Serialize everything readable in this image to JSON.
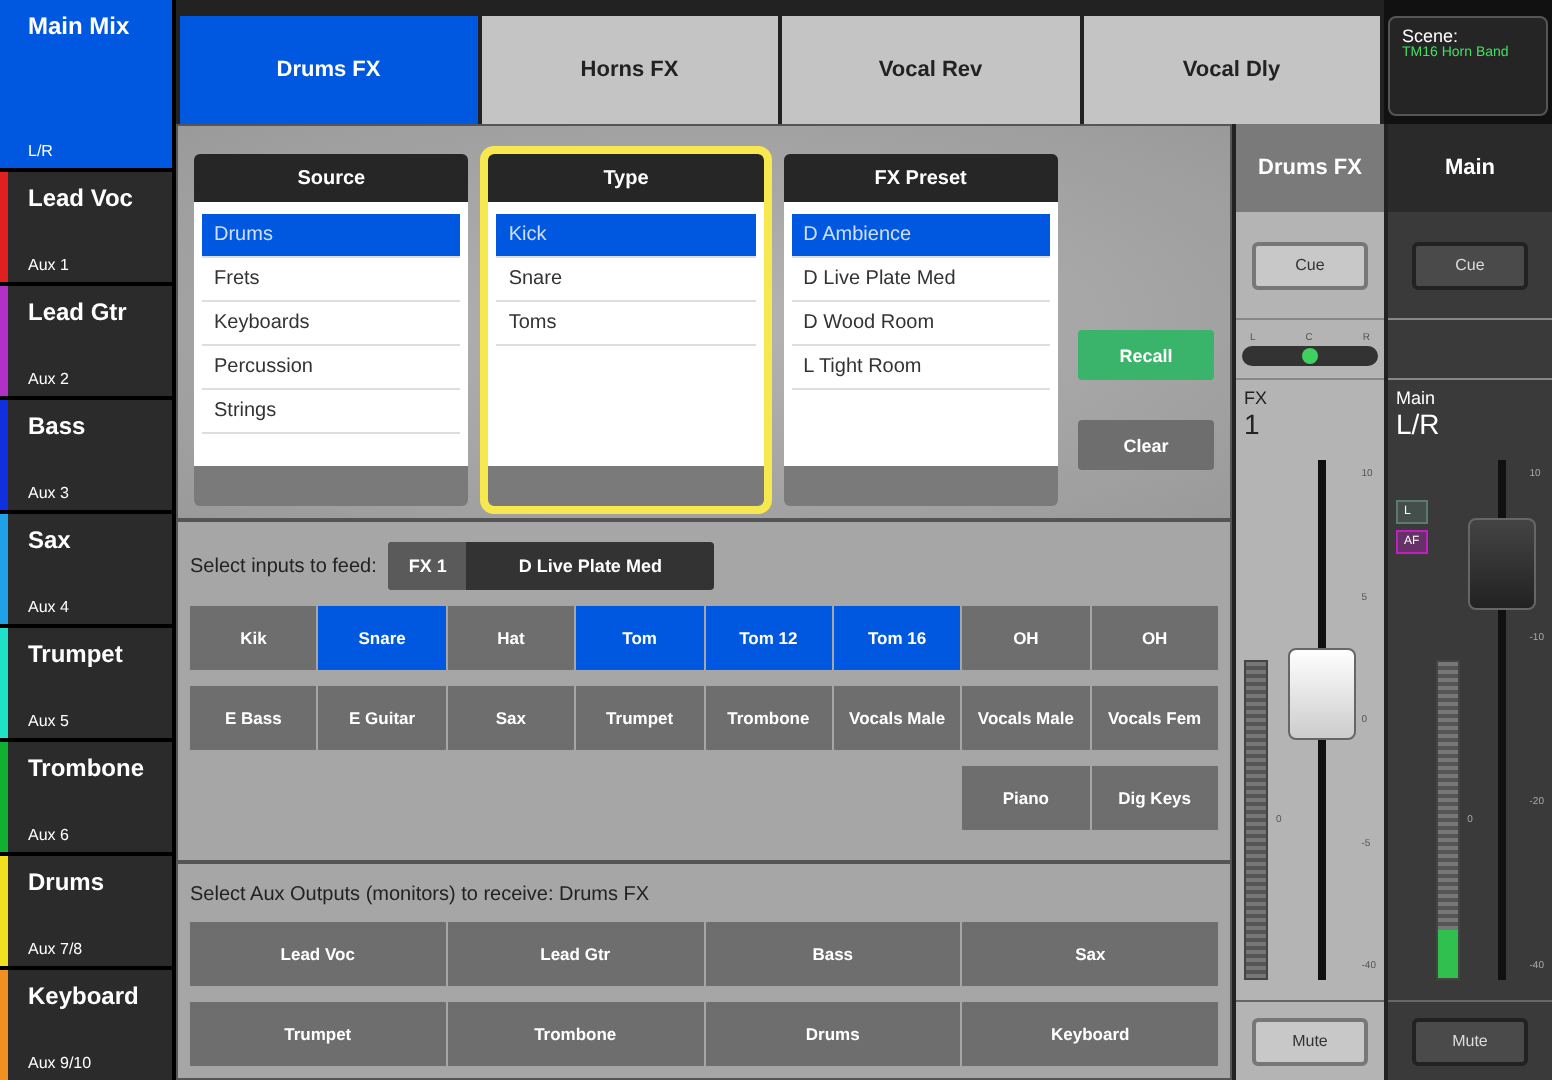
{
  "sidebar": [
    {
      "name": "Main Mix",
      "bus": "L/R",
      "selected": true
    },
    {
      "name": "Lead Voc",
      "bus": "Aux 1",
      "color": "#e02020",
      "selected": false
    },
    {
      "name": "Lead Gtr",
      "bus": "Aux 2",
      "color": "#b030c8",
      "selected": false
    },
    {
      "name": "Bass",
      "bus": "Aux 3",
      "color": "#1030e0",
      "selected": false
    },
    {
      "name": "Sax",
      "bus": "Aux 4",
      "color": "#20a0e8",
      "selected": false
    },
    {
      "name": "Trumpet",
      "bus": "Aux 5",
      "color": "#20e0c8",
      "selected": false
    },
    {
      "name": "Trombone",
      "bus": "Aux 6",
      "color": "#10b030",
      "selected": false
    },
    {
      "name": "Drums",
      "bus": "Aux 7/8",
      "color": "#f0e020",
      "selected": false
    },
    {
      "name": "Keyboard",
      "bus": "Aux 9/10",
      "color": "#f09020",
      "selected": false
    }
  ],
  "tabs": [
    {
      "label": "Drums FX",
      "selected": true
    },
    {
      "label": "Horns FX",
      "selected": false
    },
    {
      "label": "Vocal Rev",
      "selected": false
    },
    {
      "label": "Vocal Dly",
      "selected": false
    }
  ],
  "scene": {
    "label": "Scene:",
    "name": "TM16 Horn Band"
  },
  "pickers": [
    {
      "title": "Source",
      "focused": false,
      "items": [
        {
          "label": "Drums",
          "selected": true
        },
        {
          "label": "Frets",
          "selected": false
        },
        {
          "label": "Keyboards",
          "selected": false
        },
        {
          "label": "Percussion",
          "selected": false
        },
        {
          "label": "Strings",
          "selected": false
        }
      ]
    },
    {
      "title": "Type",
      "focused": true,
      "items": [
        {
          "label": "Kick",
          "selected": true
        },
        {
          "label": "Snare",
          "selected": false
        },
        {
          "label": "Toms",
          "selected": false
        }
      ]
    },
    {
      "title": "FX Preset",
      "focused": false,
      "items": [
        {
          "label": "D Ambience",
          "selected": true
        },
        {
          "label": "D Live Plate Med",
          "selected": false
        },
        {
          "label": "D Wood Room",
          "selected": false
        },
        {
          "label": "L Tight Room",
          "selected": false
        }
      ]
    }
  ],
  "actions": [
    {
      "label": "Recall",
      "kind": "recall"
    },
    {
      "label": "Clear",
      "kind": "clear"
    }
  ],
  "feed": {
    "label": "Select inputs to feed:",
    "fx": "FX 1",
    "preset": "D Live Plate Med"
  },
  "inputs": [
    [
      {
        "label": "Kik",
        "selected": false
      },
      {
        "label": "Snare",
        "selected": true
      },
      {
        "label": "Hat",
        "selected": false
      },
      {
        "label": "Tom",
        "selected": true
      },
      {
        "label": "Tom 12",
        "selected": true
      },
      {
        "label": "Tom 16",
        "selected": true
      },
      {
        "label": "OH",
        "selected": false
      },
      {
        "label": "OH",
        "selected": false
      }
    ],
    [
      {
        "label": "E Bass",
        "selected": false
      },
      {
        "label": "E Guitar",
        "selected": false
      },
      {
        "label": "Sax",
        "selected": false
      },
      {
        "label": "Trumpet",
        "selected": false
      },
      {
        "label": "Trombone",
        "selected": false
      },
      {
        "label": "Vocals Male",
        "selected": false
      },
      {
        "label": "Vocals Male",
        "selected": false
      },
      {
        "label": "Vocals Fem",
        "selected": false
      }
    ],
    [
      {
        "label": "Piano",
        "selected": false
      },
      {
        "label": "Dig Keys",
        "selected": false
      }
    ]
  ],
  "aux": {
    "label": "Select Aux Outputs (monitors) to receive:  Drums FX",
    "outputs": [
      [
        {
          "label": "Lead Voc",
          "selected": false
        },
        {
          "label": "Lead Gtr",
          "selected": false
        },
        {
          "label": "Bass",
          "selected": false
        },
        {
          "label": "Sax",
          "selected": false
        }
      ],
      [
        {
          "label": "Trumpet",
          "selected": false
        },
        {
          "label": "Trombone",
          "selected": false
        },
        {
          "label": "Drums",
          "selected": false
        },
        {
          "label": "Keyboard",
          "selected": false
        }
      ]
    ]
  },
  "strips": [
    {
      "kind": "fx",
      "title": "Drums FX",
      "cue": "Cue",
      "pan": {
        "labels": [
          "L",
          "C",
          "R"
        ],
        "level": 0.5
      },
      "type": "FX",
      "name": "1",
      "scale": [
        "10",
        "5",
        "0",
        "-5",
        "-40"
      ],
      "meter_label": "0",
      "fader": {
        "level": 0.55
      },
      "mute": "Mute"
    },
    {
      "kind": "main",
      "title": "Main",
      "cue": "Cue",
      "type": "Main",
      "name": "L/R",
      "badges": [
        {
          "label": "L",
          "color": "#5a7a70"
        },
        {
          "label": "AF",
          "color": "#c020c0"
        }
      ],
      "scale": [
        "10",
        "-10",
        "-20",
        "-40"
      ],
      "meter_label": "0",
      "fader": {
        "level": 0.8
      },
      "meter": {
        "level": 0.15
      },
      "mute": "Mute"
    }
  ]
}
